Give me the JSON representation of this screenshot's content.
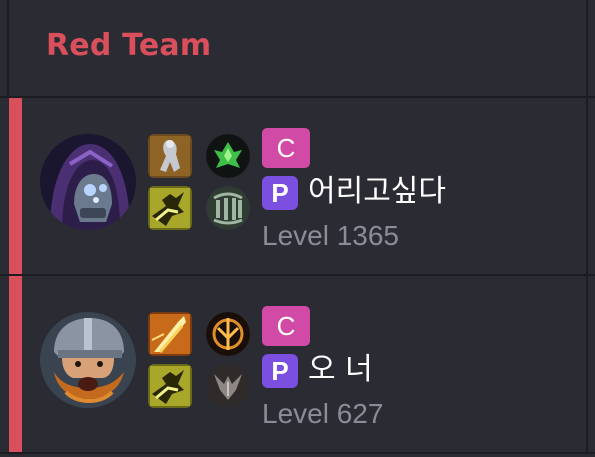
{
  "team": {
    "title": "Red Team",
    "accent_color": "#d94f5c"
  },
  "colors": {
    "background": "#2b2b33",
    "divider": "#1c1c21",
    "role_badge": "#d14aa6",
    "p_badge": "#7b4fe0",
    "level_text": "#8c8c98",
    "name_text": "#ffffff"
  },
  "players": [
    {
      "avatar_icon": "hooded-champion-portrait-icon",
      "summoner_spells": [
        "ghost-spell-icon",
        "flash-spell-icon"
      ],
      "runes": [
        "green-precision-rune-icon",
        "resolve-tree-rune-icon"
      ],
      "role_badge": "C",
      "p_badge": "P",
      "name": "어리고싶다",
      "level": "Level 1365"
    },
    {
      "avatar_icon": "bearded-warrior-portrait-icon",
      "summoner_spells": [
        "smite-spell-icon",
        "flash-spell-icon"
      ],
      "runes": [
        "sorcery-rune-icon",
        "domination-tree-rune-icon"
      ],
      "role_badge": "C",
      "p_badge": "P",
      "name": "오 너",
      "level": "Level 627"
    }
  ]
}
